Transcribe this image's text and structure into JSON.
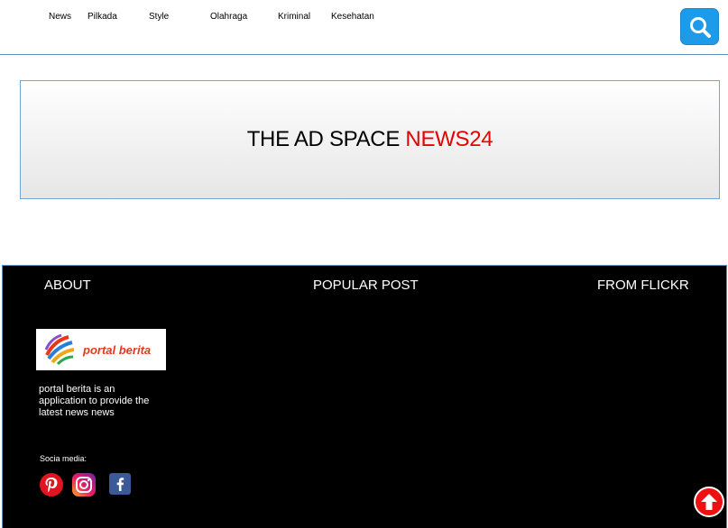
{
  "nav": {
    "items": [
      {
        "label": "News"
      },
      {
        "label": "Pilkada"
      },
      {
        "label": "Style"
      },
      {
        "label": "Olahraga"
      },
      {
        "label": "Kriminal"
      },
      {
        "label": "Kesehatan"
      }
    ],
    "search_icon": "search-icon"
  },
  "ad": {
    "text": "THE AD SPACE",
    "accent": "NEWS24",
    "accent_color": "#e60000"
  },
  "footer": {
    "about_heading": "ABOUT",
    "popular_heading": "POPULAR POST",
    "flickr_heading": "FROM FLICKR",
    "logo_text": "portal berita",
    "about_text": "portal berita is an application to provide the latest news news",
    "social_label": "Socia media:",
    "social_icons": [
      "pinterest-icon",
      "instagram-icon",
      "facebook-icon"
    ],
    "scroll_top_icon": "arrow-up-icon"
  },
  "colors": {
    "accent_blue": "#1e9be8",
    "footer_bg": "#000000",
    "scroll_red": "#f01010"
  }
}
